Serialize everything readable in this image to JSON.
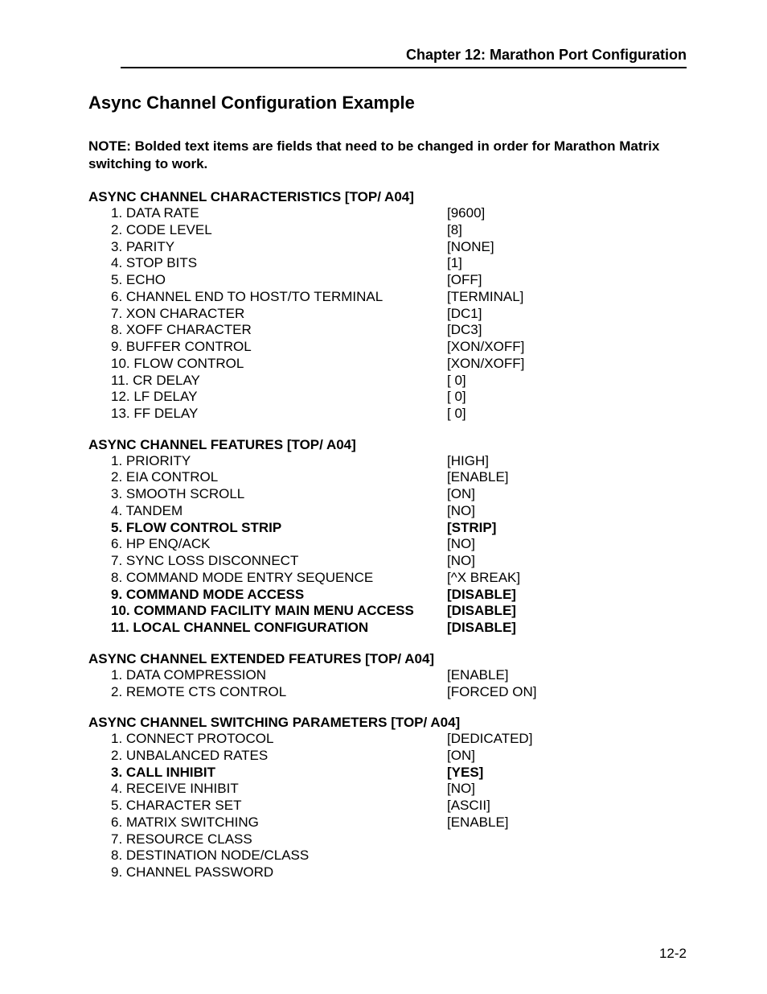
{
  "chapterHeader": "Chapter 12: Marathon Port Configuration",
  "mainTitle": "Async Channel Configuration Example",
  "note": "NOTE:  Bolded text items are fields that need to be changed in order for Marathon Matrix switching to work.",
  "pageNumber": "12-2",
  "sections": [
    {
      "heading": "ASYNC CHANNEL CHARACTERISTICS [TOP/ A04]",
      "rows": [
        {
          "label": "1. DATA RATE",
          "value": "[9600]",
          "bold": false
        },
        {
          "label": "2. CODE LEVEL",
          "value": "[8]",
          "bold": false
        },
        {
          "label": "3. PARITY",
          "value": "[NONE]",
          "bold": false
        },
        {
          "label": "4. STOP BITS",
          "value": "[1]",
          "bold": false
        },
        {
          "label": "5. ECHO",
          "value": "[OFF]",
          "bold": false
        },
        {
          "label": "6. CHANNEL END TO HOST/TO TERMINAL",
          "value": "[TERMINAL]",
          "bold": false
        },
        {
          "label": "7. XON CHARACTER",
          "value": "[DC1]",
          "bold": false
        },
        {
          "label": "8. XOFF CHARACTER",
          "value": "[DC3]",
          "bold": false
        },
        {
          "label": "9. BUFFER CONTROL",
          "value": "[XON/XOFF]",
          "bold": false
        },
        {
          "label": "10. FLOW CONTROL",
          "value": "[XON/XOFF]",
          "bold": false
        },
        {
          "label": "11. CR DELAY",
          "value": "[ 0]",
          "bold": false
        },
        {
          "label": "12. LF DELAY",
          "value": "[ 0]",
          "bold": false
        },
        {
          "label": "13. FF DELAY",
          "value": "[ 0]",
          "bold": false
        }
      ]
    },
    {
      "heading": "ASYNC CHANNEL FEATURES [TOP/ A04]",
      "rows": [
        {
          "label": "1. PRIORITY",
          "value": "[HIGH]",
          "bold": false
        },
        {
          "label": "2. EIA CONTROL",
          "value": "[ENABLE]",
          "bold": false
        },
        {
          "label": "3. SMOOTH SCROLL",
          "value": "[ON]",
          "bold": false
        },
        {
          "label": "4. TANDEM",
          "value": "[NO]",
          "bold": false
        },
        {
          "label": "5. FLOW CONTROL STRIP",
          "value": "[STRIP]",
          "bold": true
        },
        {
          "label": "6. HP ENQ/ACK",
          "value": "[NO]",
          "bold": false
        },
        {
          "label": "7. SYNC LOSS DISCONNECT",
          "value": "[NO]",
          "bold": false
        },
        {
          "label": "8. COMMAND MODE ENTRY SEQUENCE",
          "value": "[^X BREAK]",
          "bold": false
        },
        {
          "label": "9. COMMAND MODE ACCESS",
          "value": "[DISABLE]",
          "bold": true
        },
        {
          "label": "10. COMMAND FACILITY MAIN MENU ACCESS",
          "value": "[DISABLE]",
          "bold": true
        },
        {
          "label": "11. LOCAL CHANNEL CONFIGURATION",
          "value": "[DISABLE]",
          "bold": true
        }
      ]
    },
    {
      "heading": "ASYNC CHANNEL EXTENDED FEATURES [TOP/ A04]",
      "rows": [
        {
          "label": "1. DATA COMPRESSION",
          "value": "[ENABLE]",
          "bold": false
        },
        {
          "label": "2. REMOTE CTS CONTROL",
          "value": "[FORCED ON]",
          "bold": false
        }
      ]
    },
    {
      "heading": "ASYNC CHANNEL SWITCHING PARAMETERS [TOP/ A04]",
      "rows": [
        {
          "label": "1. CONNECT PROTOCOL",
          "value": "[DEDICATED]",
          "bold": false
        },
        {
          "label": "2. UNBALANCED RATES",
          "value": "[ON]",
          "bold": false
        },
        {
          "label": "3. CALL INHIBIT",
          "value": "[YES]",
          "bold": true
        },
        {
          "label": "4. RECEIVE INHIBIT",
          "value": "[NO]",
          "bold": false
        },
        {
          "label": "5. CHARACTER SET",
          "value": "[ASCII]",
          "bold": false
        },
        {
          "label": "6. MATRIX SWITCHING",
          "value": "[ENABLE]",
          "bold": false
        },
        {
          "label": "7. RESOURCE CLASS",
          "value": "",
          "bold": false
        },
        {
          "label": "8. DESTINATION NODE/CLASS",
          "value": "",
          "bold": false
        },
        {
          "label": "9. CHANNEL PASSWORD",
          "value": "",
          "bold": false
        }
      ]
    }
  ]
}
